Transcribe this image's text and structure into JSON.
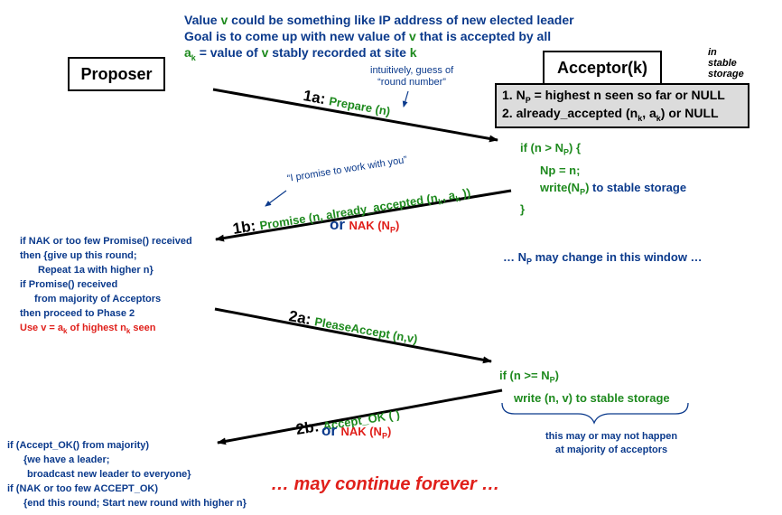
{
  "header": {
    "line1_a": "Value ",
    "line1_v": "v",
    "line1_b": " could be something like IP address of new elected leader",
    "line2_a": "Goal is to come up with new value of ",
    "line2_v": "v",
    "line2_b": " that is accepted by all",
    "line3_a": "a",
    "line3_sub": "k",
    "line3_b": " = value of ",
    "line3_v": "v",
    "line3_c": " stably recorded at site ",
    "line3_k": "k"
  },
  "proposer": {
    "label": "Proposer"
  },
  "acceptor": {
    "label": "Acceptor(k)",
    "storage_note": [
      "in",
      "stable",
      "storage"
    ],
    "state1_a": "1. N",
    "state1_sub": "P",
    "state1_b": " = highest n seen so far or NULL",
    "state2_a": "2. already_accepted (n",
    "state2_sub1": "k",
    "state2_b": ", a",
    "state2_sub2": "k",
    "state2_c": ") or NULL"
  },
  "msg1a": {
    "tag": "1a:",
    "text": "Prepare (n)",
    "note": [
      "intuitively, guess of",
      "“round number”"
    ]
  },
  "handler1": {
    "l1_a": "if (n > N",
    "l1_sub": "P",
    "l1_b": ") {",
    "l2": "Np = n;",
    "l3_a": "write(N",
    "l3_sub": "P",
    "l3_b": ")",
    "l3_c": " to stable storage",
    "l4": "}"
  },
  "msg1b": {
    "tag": "1b:",
    "text_a": "Promise (n, already_accepted (n",
    "text_sub1": "k",
    "text_b": ", a",
    "text_sub2": "k",
    "text_c": " ))",
    "or": "or",
    "nak_a": "NAK (N",
    "nak_sub": "P",
    "nak_b": ")",
    "note": "“I promise to work with you”"
  },
  "window_note": {
    "a": "… N",
    "sub": "P",
    "b": " may change in this window …"
  },
  "proposer_logic1": {
    "l1": "if NAK or too few Promise() received",
    "l2": "then {give up this round;",
    "l3": "Repeat 1a with higher n}",
    "l4": "if Promise() received",
    "l5": "from majority of Acceptors",
    "l6": "then proceed to Phase 2",
    "l7_a": "Use v = a",
    "l7_sub": "k",
    "l7_b": " of highest n",
    "l7_sub2": "k",
    "l7_c": " seen"
  },
  "msg2a": {
    "tag": "2a:",
    "text": "PleaseAccept (n,v)"
  },
  "handler2": {
    "l1_a": "if (n >= N",
    "l1_sub": "P",
    "l1_b": ")",
    "l2": "write (n, v) to stable storage"
  },
  "msg2b": {
    "tag": "2b:",
    "text": "Accept_OK ( )",
    "or": "or",
    "nak_a": "NAK (N",
    "nak_sub": "P",
    "nak_b": ")"
  },
  "majority_note": [
    "this may or may not happen",
    "at majority of acceptors"
  ],
  "proposer_logic2": {
    "l1": "if (Accept_OK() from majority)",
    "l2": "{we have a leader;",
    "l3": "broadcast new leader to everyone}",
    "l4": "if (NAK or too few ACCEPT_OK)",
    "l5": "{end this round; Start new round with higher n}"
  },
  "continue_note": "… may continue forever …",
  "colors": {
    "blue": "#0b3a8c",
    "green": "#1e8a1e",
    "red": "#e0201b",
    "gray_box": "#dcdcdc"
  }
}
